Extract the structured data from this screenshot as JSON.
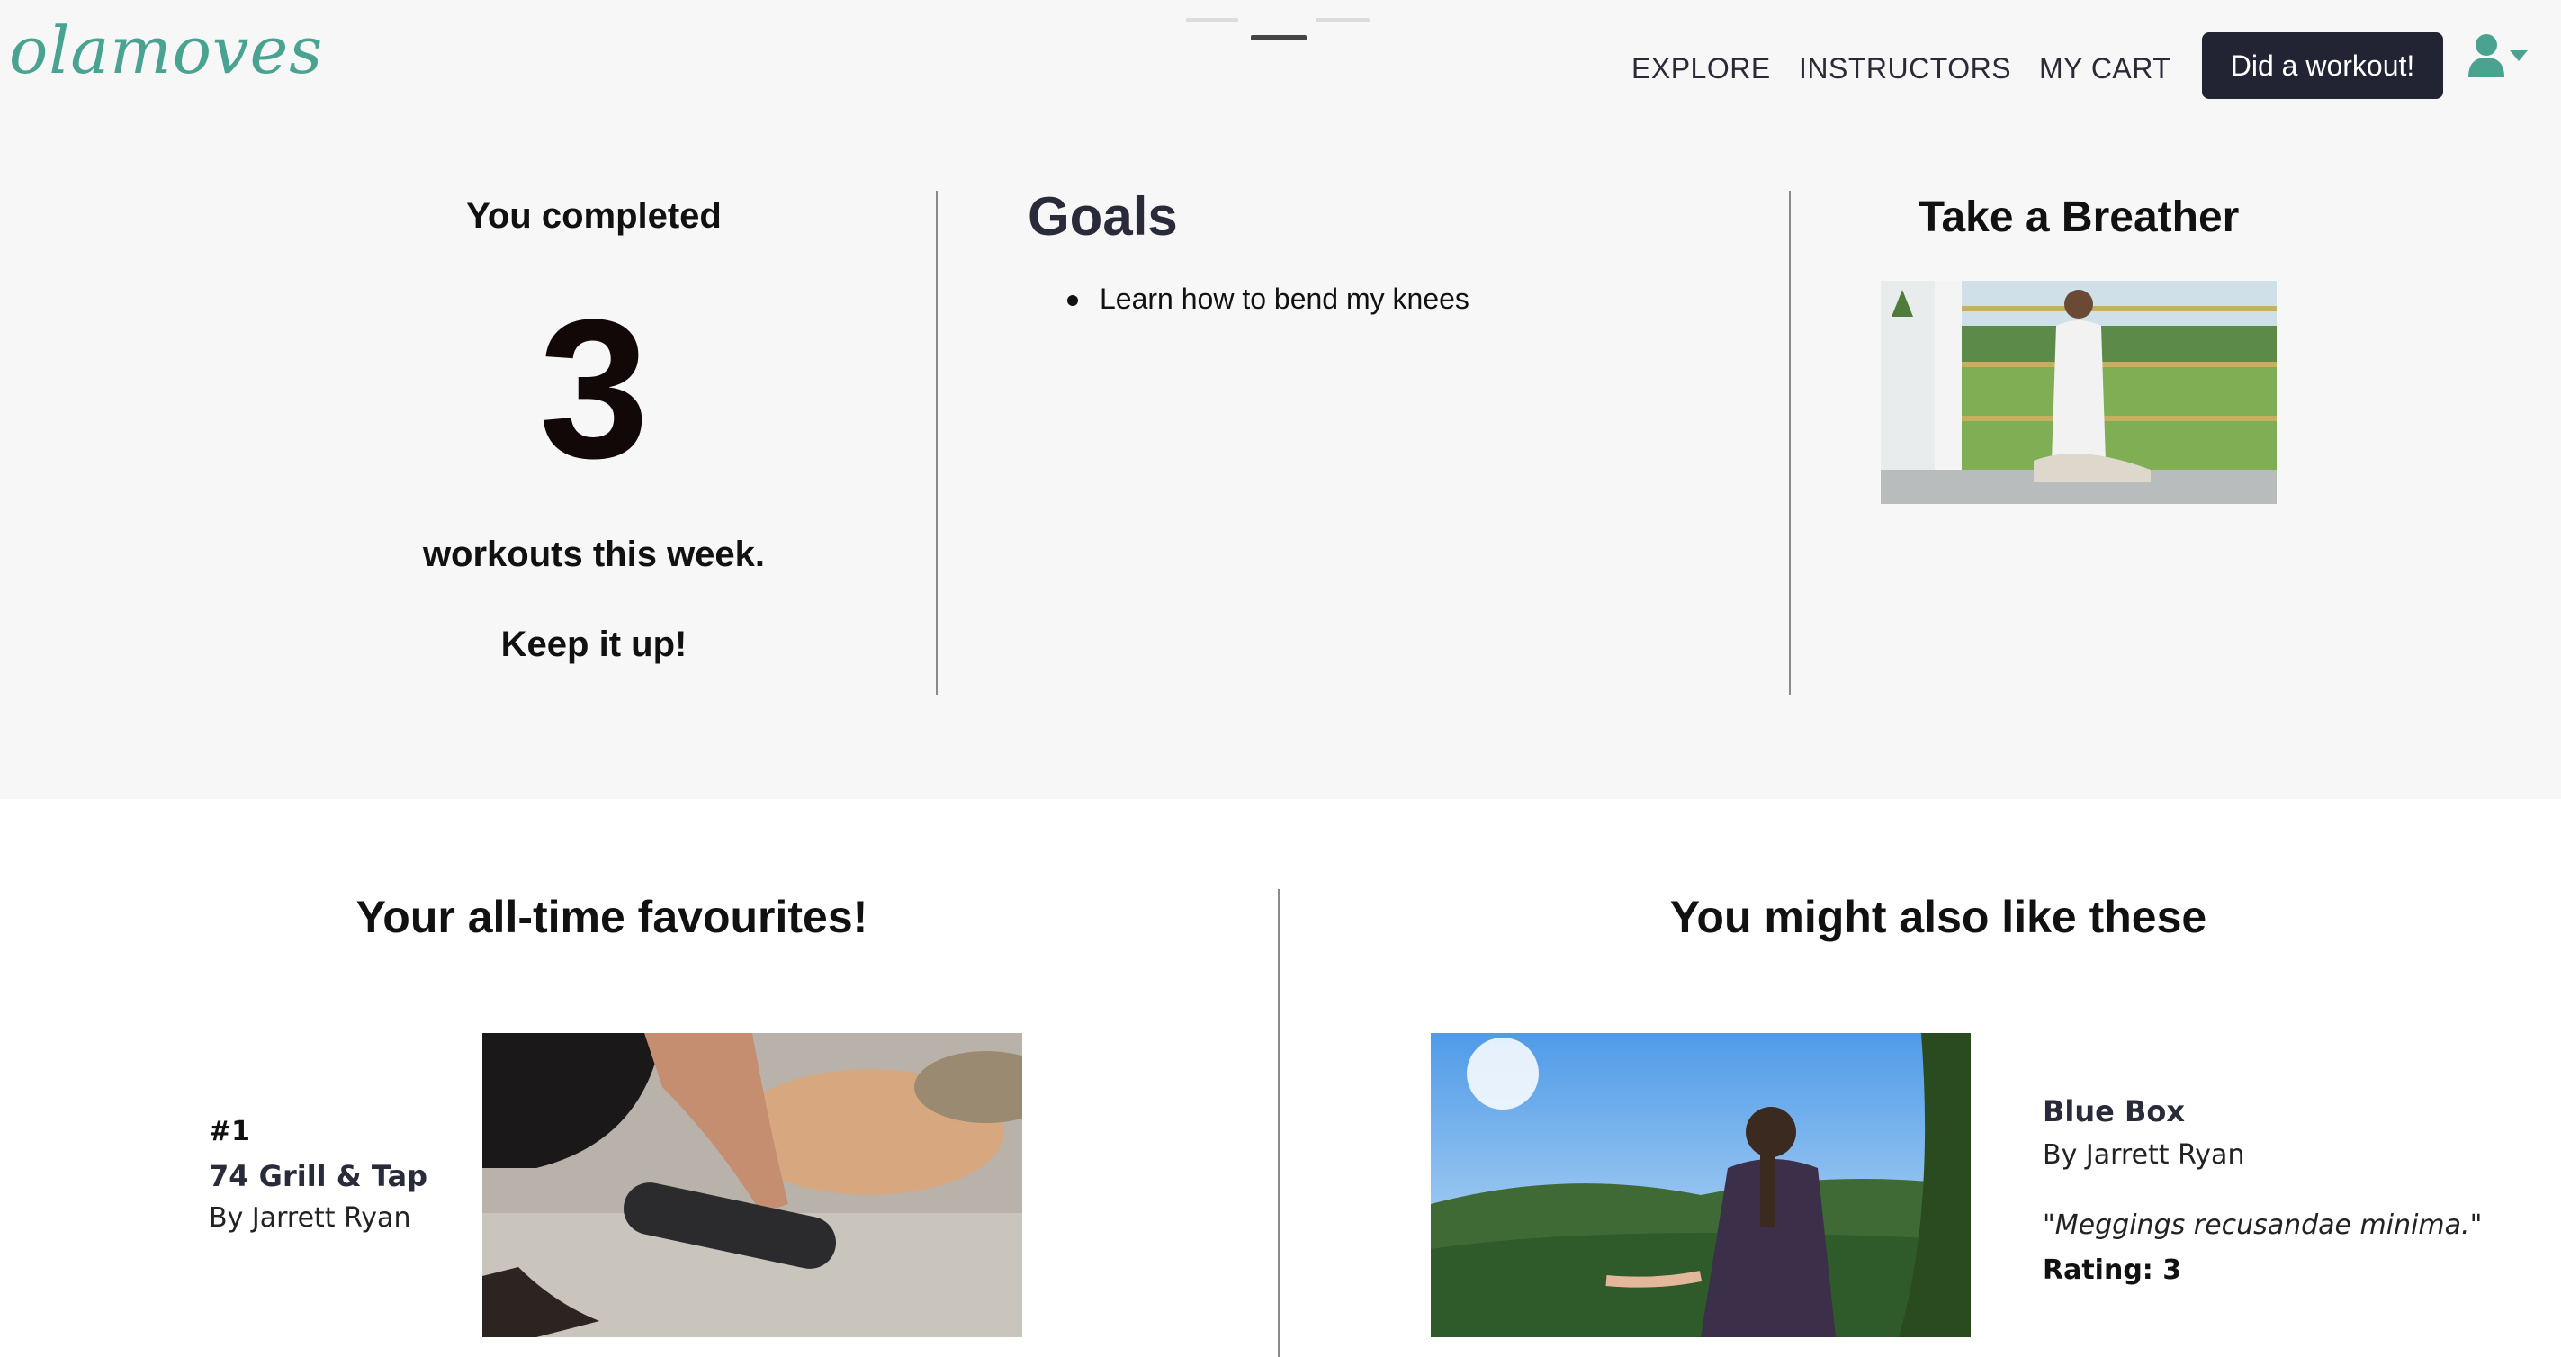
{
  "brand": {
    "logo": "olamoves",
    "accent": "#4aa391"
  },
  "nav": {
    "explore": "EXPLORE",
    "instructors": "INSTRUCTORS",
    "cart": "MY CART",
    "workout_button": "Did a workout!",
    "user_icon": "user-icon"
  },
  "carousel": {
    "slide_count": 3,
    "active_index": 1
  },
  "stats": {
    "title": "You completed",
    "count": "3",
    "subtitle": "workouts this week.",
    "encouragement": "Keep it up!"
  },
  "goals": {
    "title": "Goals",
    "items": [
      "Learn how to bend my knees"
    ]
  },
  "breather": {
    "title": "Take a Breather"
  },
  "favourites": {
    "title": "Your all-time favourites!",
    "items": [
      {
        "rank": "#1",
        "name": "74 Grill & Tap",
        "by": "By Jarrett Ryan"
      }
    ]
  },
  "recommendations": {
    "title": "You might also like these",
    "items": [
      {
        "name": "Blue Box",
        "by": "By Jarrett Ryan",
        "quote": "\"Meggings recusandae minima.\"",
        "rating": "Rating: 3"
      }
    ]
  }
}
